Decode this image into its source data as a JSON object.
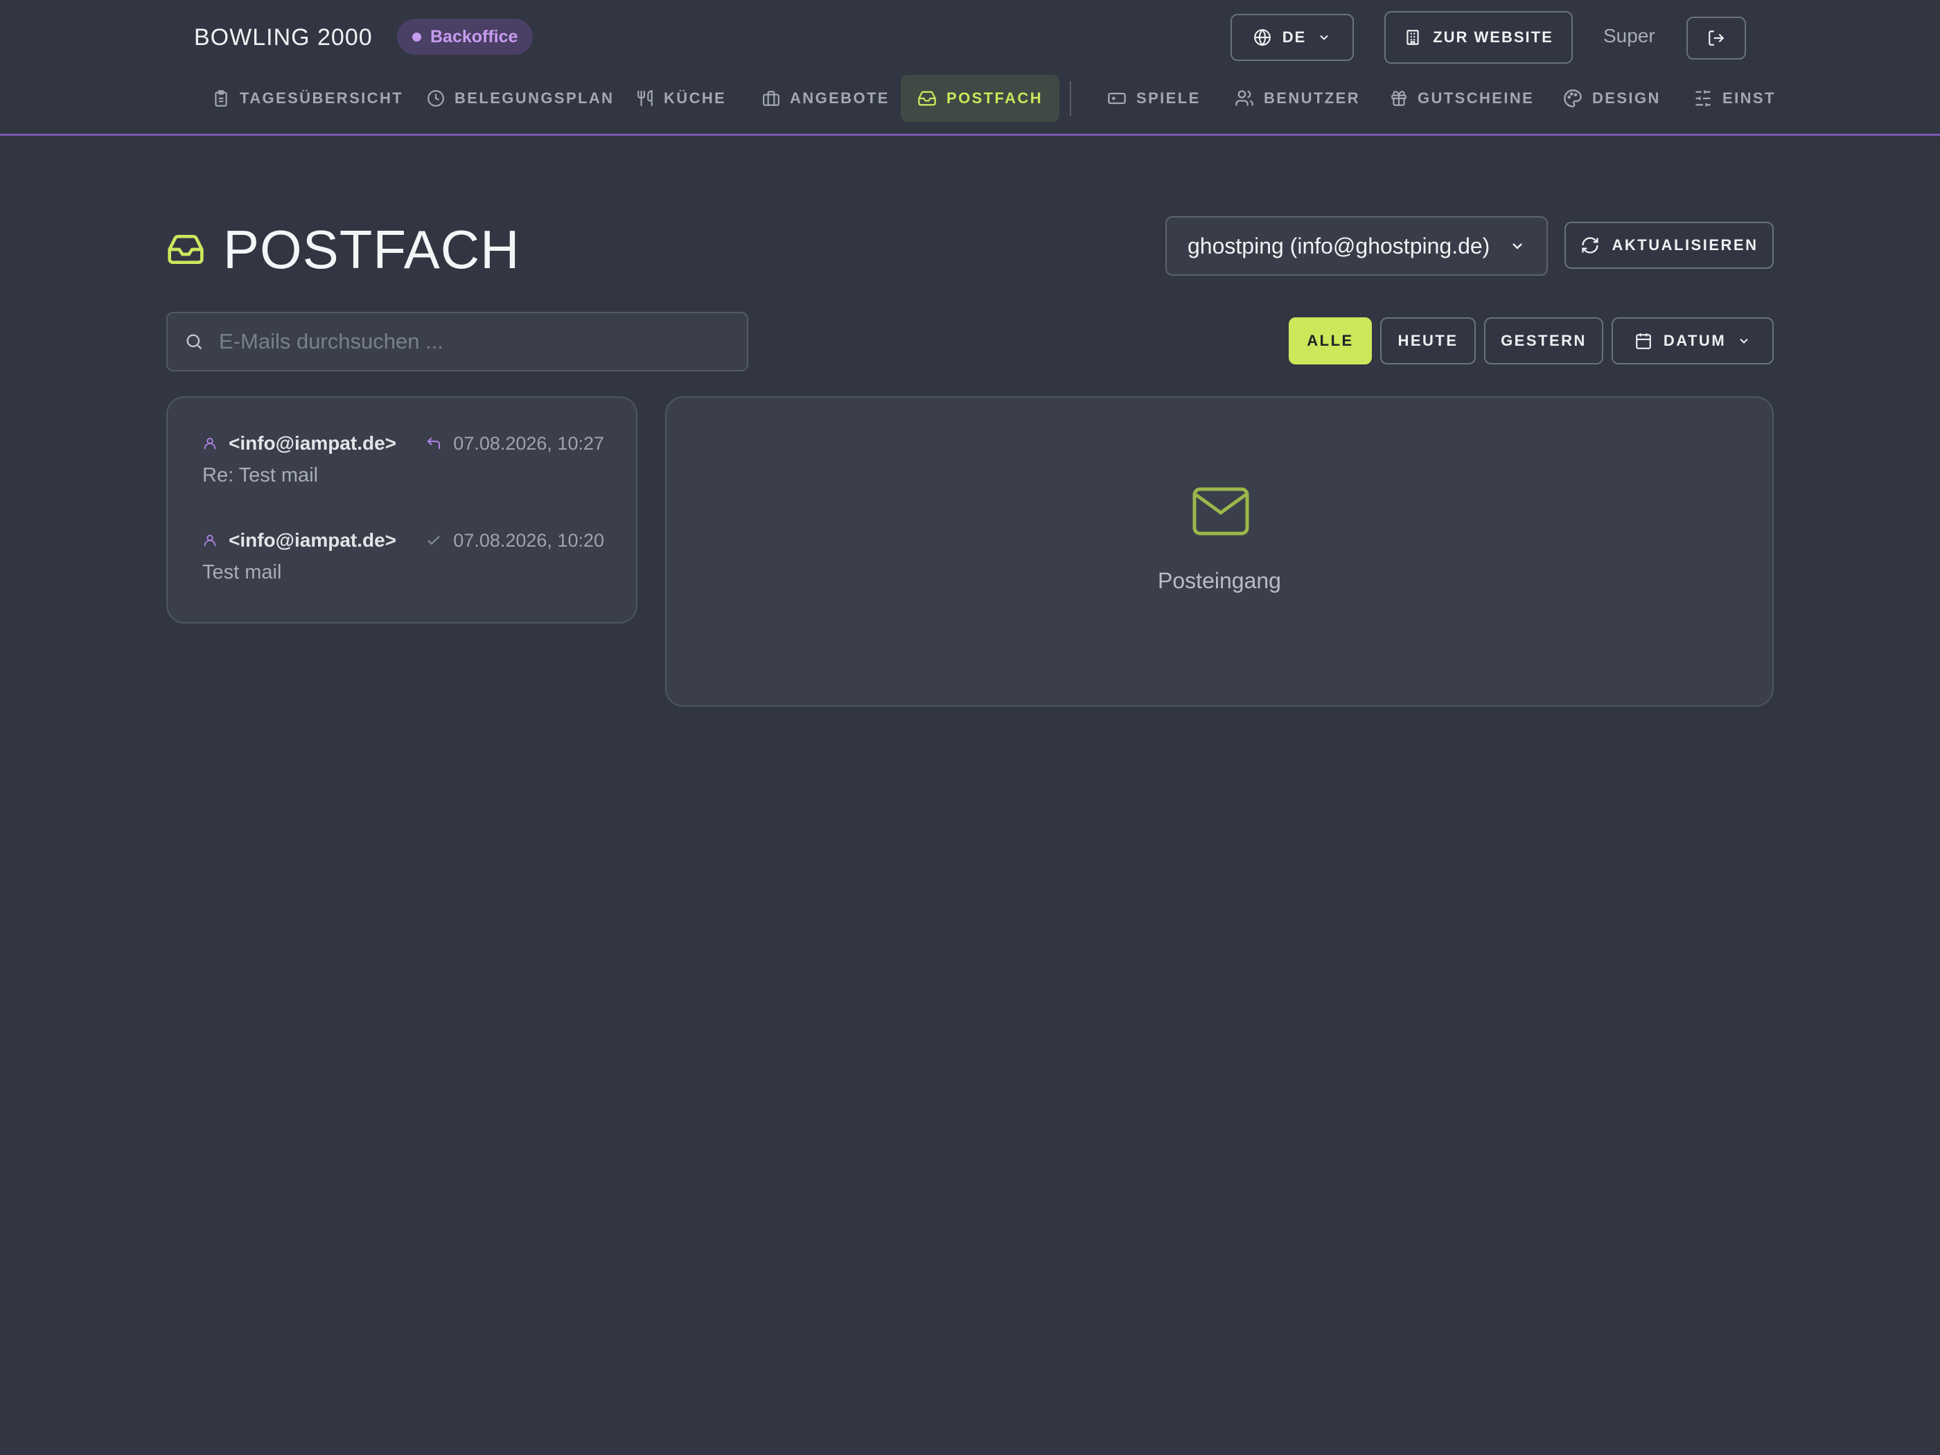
{
  "header": {
    "brand": "BOWLING 2000",
    "badge": "Backoffice",
    "language": "DE",
    "website_button": "ZUR WEBSITE",
    "user_name": "Super"
  },
  "nav": {
    "items": [
      {
        "label": "TAGESÜBERSICHT",
        "icon": "clipboard-icon"
      },
      {
        "label": "BELEGUNGSPLAN",
        "icon": "clock-icon"
      },
      {
        "label": "KÜCHE",
        "icon": "utensils-icon"
      },
      {
        "label": "ANGEBOTE",
        "icon": "briefcase-icon"
      },
      {
        "label": "POSTFACH",
        "icon": "inbox-icon",
        "active": true
      },
      {
        "label": "SPIELE",
        "icon": "ticket-icon"
      },
      {
        "label": "BENUTZER",
        "icon": "users-icon"
      },
      {
        "label": "GUTSCHEINE",
        "icon": "gift-icon"
      },
      {
        "label": "DESIGN",
        "icon": "palette-icon"
      },
      {
        "label": "EINST",
        "icon": "sliders-icon"
      }
    ]
  },
  "main": {
    "title": "POSTFACH",
    "account": "ghostping (info@ghostping.de)",
    "refresh_button": "AKTUALISIEREN",
    "search_placeholder": "E-Mails durchsuchen ...",
    "filters": {
      "all": "ALLE",
      "today": "HEUTE",
      "yesterday": "GESTERN",
      "date": "DATUM"
    },
    "mails": [
      {
        "from": "<info@iampat.de>",
        "status_icon": "reply-icon",
        "date": "07.08.2026, 10:27",
        "subject": "Re: Test mail"
      },
      {
        "from": "<info@iampat.de>",
        "status_icon": "check-icon",
        "date": "07.08.2026, 10:20",
        "subject": "Test mail"
      }
    ],
    "preview_label": "Posteingang"
  },
  "colors": {
    "background": "#313642",
    "accent_green": "#cbe85a",
    "accent_purple": "#7e58b6",
    "badge_text": "#c79cf1"
  }
}
